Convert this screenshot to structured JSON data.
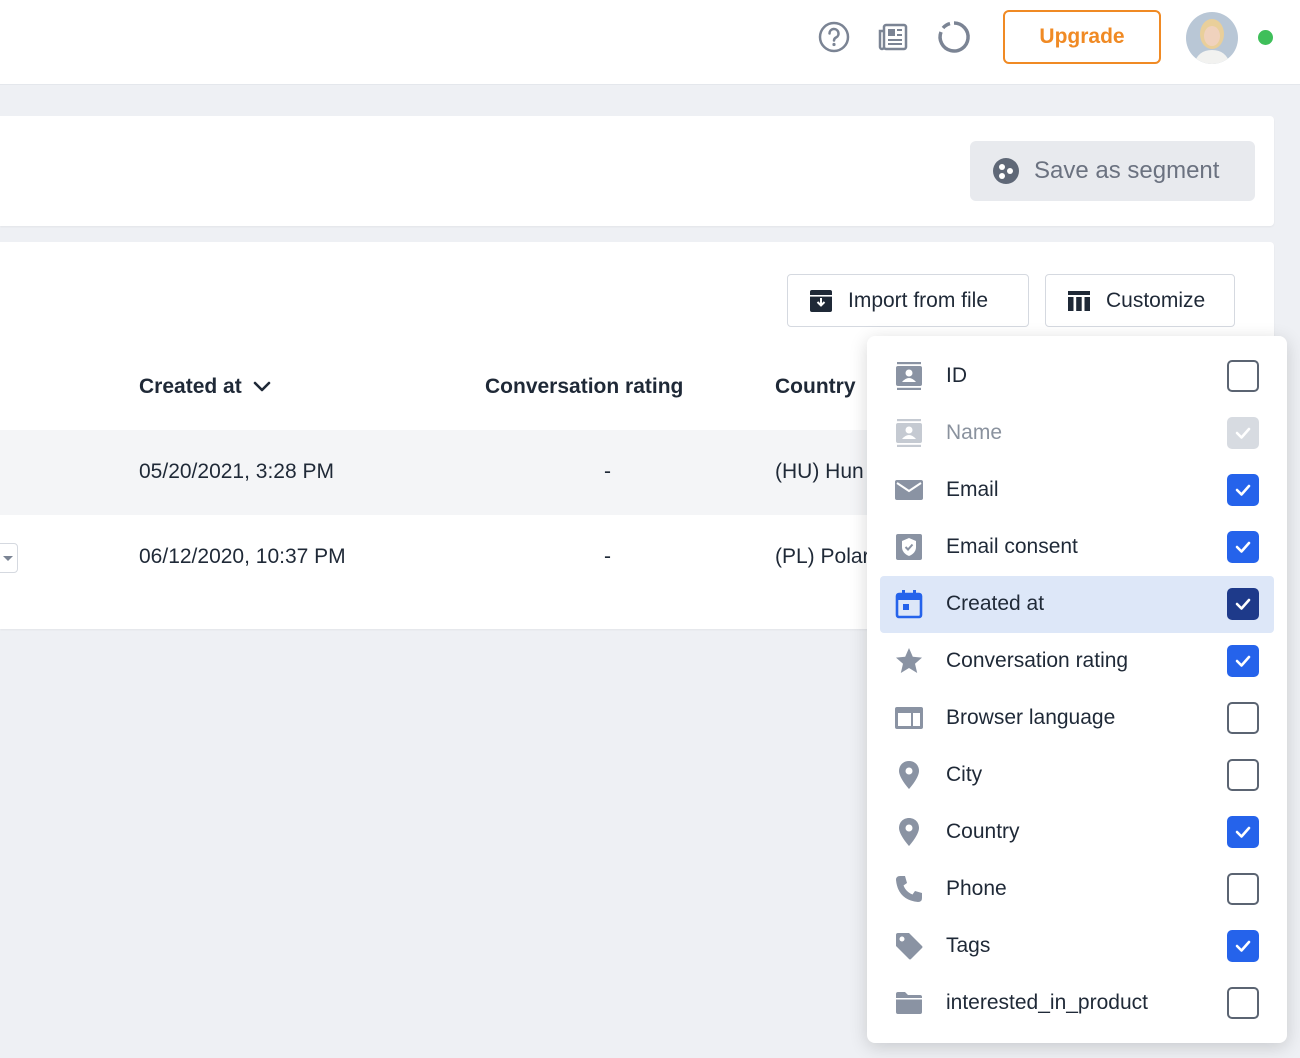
{
  "header": {
    "upgrade_label": "Upgrade",
    "icons": [
      "help-circle-icon",
      "news-icon",
      "loading-circle-icon"
    ],
    "status_color": "#3fbf5a"
  },
  "toolbar": {
    "save_segment_label": "Save as segment",
    "import_label": "Import from file",
    "customize_label": "Customize"
  },
  "table": {
    "columns": [
      "Created at",
      "Conversation rating",
      "Country"
    ],
    "rows": [
      {
        "created_at": "05/20/2021, 3:28 PM",
        "rating": "-",
        "country": "(HU) Hun"
      },
      {
        "created_at": "06/12/2020, 10:37 PM",
        "rating": "-",
        "country": "(PL) Polar"
      }
    ]
  },
  "customize_menu": {
    "items": [
      {
        "label": "ID",
        "icon": "contact-card-icon",
        "checked": false,
        "state": "normal"
      },
      {
        "label": "Name",
        "icon": "contact-card-icon",
        "checked": true,
        "state": "disabled"
      },
      {
        "label": "Email",
        "icon": "envelope-icon",
        "checked": true,
        "state": "normal"
      },
      {
        "label": "Email consent",
        "icon": "shield-check-icon",
        "checked": true,
        "state": "normal"
      },
      {
        "label": "Created at",
        "icon": "calendar-icon",
        "checked": true,
        "state": "active"
      },
      {
        "label": "Conversation rating",
        "icon": "star-icon",
        "checked": true,
        "state": "normal"
      },
      {
        "label": "Browser language",
        "icon": "browser-window-icon",
        "checked": false,
        "state": "normal"
      },
      {
        "label": "City",
        "icon": "map-pin-icon",
        "checked": false,
        "state": "normal"
      },
      {
        "label": "Country",
        "icon": "map-pin-icon",
        "checked": true,
        "state": "normal"
      },
      {
        "label": "Phone",
        "icon": "phone-icon",
        "checked": false,
        "state": "normal"
      },
      {
        "label": "Tags",
        "icon": "tag-icon",
        "checked": true,
        "state": "normal"
      },
      {
        "label": "interested_in_product",
        "icon": "folder-icon",
        "checked": false,
        "state": "normal"
      }
    ],
    "colors": {
      "checked": "#2563eb",
      "active_bg": "#dde7f8",
      "icon": "#8a93a3"
    }
  }
}
